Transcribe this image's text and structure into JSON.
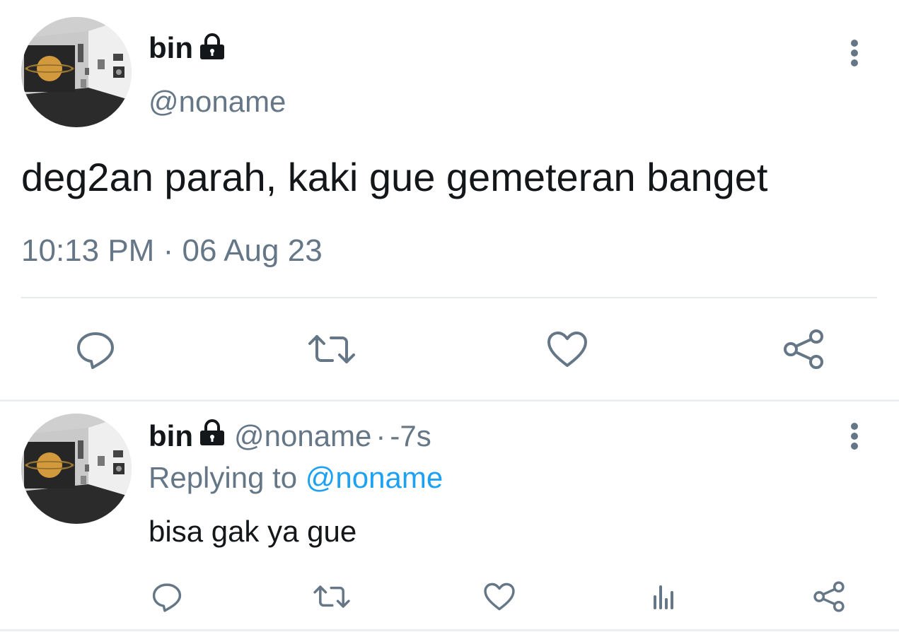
{
  "main_tweet": {
    "author_name": "bin",
    "handle": "@noname",
    "text": "deg2an parah, kaki gue gemeteran banget",
    "time": "10:13 PM",
    "date_sep": "·",
    "date": "06 Aug 23",
    "locked": true
  },
  "reply_tweet": {
    "author_name": "bin",
    "handle": "@noname",
    "time_sep": "·",
    "time": "-7s",
    "replying_prefix": "Replying to",
    "replying_to": "@noname",
    "text": "bisa gak ya gue",
    "locked": true
  },
  "icons": {
    "reply": "reply-icon",
    "retweet": "retweet-icon",
    "like": "heart-icon",
    "share": "share-icon",
    "analytics": "analytics-icon",
    "more": "more-vertical-icon",
    "lock": "lock-icon"
  },
  "colors": {
    "text": "#14171a",
    "muted": "#657786",
    "link": "#1da1f2",
    "divider": "#e6e9ec"
  }
}
